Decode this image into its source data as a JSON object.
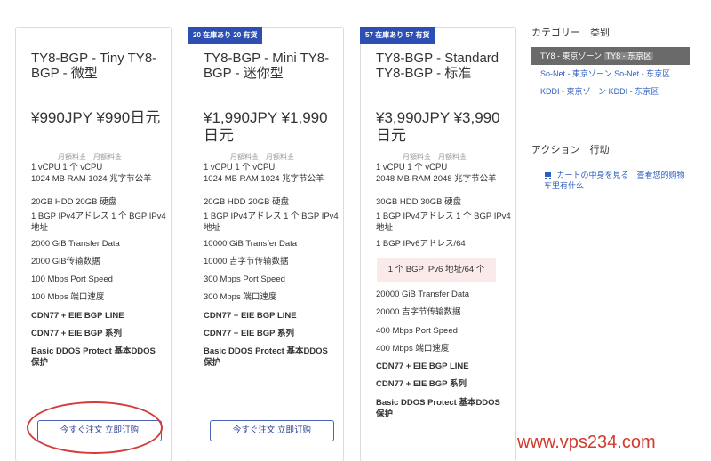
{
  "cards": [
    {
      "ribbon": "",
      "title": "TY8-BGP - Tiny TY8-BGP - 微型",
      "price": "¥990JPY ¥990日元",
      "cycle": "月額料金　月额料金",
      "features": [
        "1 vCPU 1 个 vCPU",
        "1024 MB RAM 1024 兆字节公羊",
        "20GB HDD 20GB 硬盘",
        "1 BGP IPv4アドレス 1 个 BGP IPv4 地址",
        "2000 GiB Transfer Data",
        "2000 GiB传输数据",
        "100 Mbps Port Speed",
        "100 Mbps 端口速度",
        "CDN77 + EIE BGP LINE",
        "CDN77 + EIE BGP 系列",
        "Basic DDOS Protect 基本DDOS 保护"
      ],
      "order": "今すぐ注文 立即订购"
    },
    {
      "ribbon": "20 在庫あり 20 有货",
      "title": "TY8-BGP - Mini TY8-BGP - 迷你型",
      "price": "¥1,990JPY ¥1,990日元",
      "cycle": "月額料金　月额料金",
      "features": [
        "1 vCPU 1 个 vCPU",
        "1024 MB RAM 1024 兆字节公羊",
        "20GB HDD 20GB 硬盘",
        "1 BGP IPv4アドレス 1 个 BGP IPv4 地址",
        "10000 GiB Transfer Data",
        "10000 吉字节传输数据",
        "300 Mbps Port Speed",
        "300 Mbps 端口速度",
        "CDN77 + EIE BGP LINE",
        "CDN77 + EIE BGP 系列",
        "Basic DDOS Protect 基本DDOS 保护"
      ],
      "order": "今すぐ注文 立即订购"
    },
    {
      "ribbon": "57 在庫あり 57 有货",
      "title": "TY8-BGP - Standard TY8-BGP - 标准",
      "price": "¥3,990JPY ¥3,990日元",
      "cycle": "月額料金　月额料金",
      "features": [
        "1 vCPU 1 个 vCPU",
        "2048 MB RAM 2048 兆字节公羊",
        "30GB HDD 30GB 硬盘",
        "1 BGP IPv4アドレス 1 个 BGP IPv4 地址",
        "1 BGP IPv6アドレス/64",
        "20000 GiB Transfer Data",
        "20000 吉字节传输数据",
        "400 Mbps Port Speed",
        "400 Mbps 端口速度",
        "CDN77 + EIE BGP LINE",
        "CDN77 + EIE BGP 系列",
        "Basic DDOS Protect 基本DDOS 保护"
      ],
      "highlight": "1 个 BGP IPv6 地址/64 个"
    }
  ],
  "sidebar": {
    "category_heading": "カテゴリー　类别",
    "categories": [
      {
        "label": "TY8 - 東京ゾーン",
        "alt": "TY8 - 东京区"
      },
      {
        "label": "So-Net - 東京ゾーン",
        "alt": "So-Net - 东京区"
      },
      {
        "label": "KDDI - 東京ゾーン",
        "alt": "KDDI - 东京区"
      }
    ],
    "action_heading": "アクション　行动",
    "action_link": "カートの中身を見る　查看您的购物车里有什么"
  },
  "watermark": "www.vps234.com"
}
